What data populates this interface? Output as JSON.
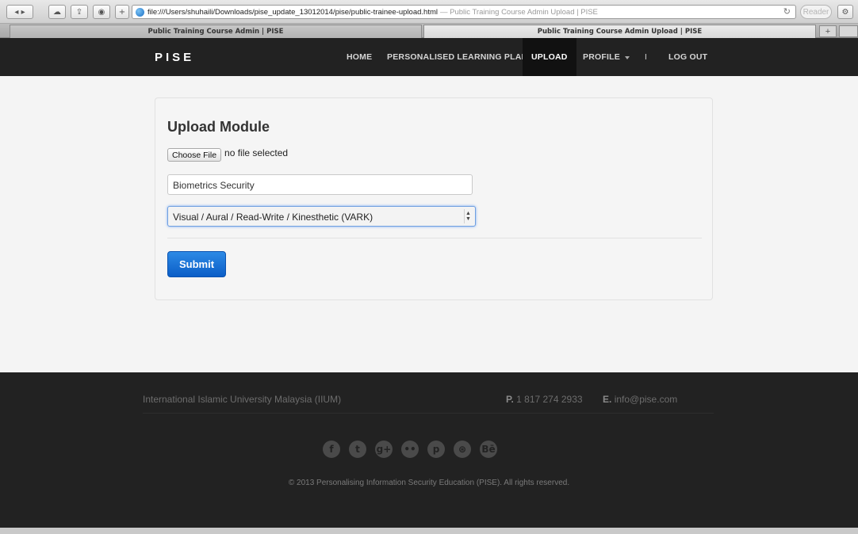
{
  "browser": {
    "url_path": "file:///Users/shuhaili/Downloads/pise_update_13012014/pise/public-trainee-upload.html",
    "url_title": "— Public Training Course Admin Upload | PISE",
    "reader_label": "Reader",
    "tabs": [
      {
        "label": "Public Training Course Admin | PISE"
      },
      {
        "label": "Public Training Course Admin Upload | PISE"
      }
    ]
  },
  "nav": {
    "brand": "PISE",
    "items": [
      {
        "label": "HOME"
      },
      {
        "label": "PERSONALISED LEARNING PLAN"
      },
      {
        "label": "UPLOAD"
      },
      {
        "label": "PROFILE"
      },
      {
        "label": "LOG OUT"
      }
    ],
    "separator": "I"
  },
  "form": {
    "title": "Upload Module",
    "choose_file_label": "Choose File",
    "file_status": "no file selected",
    "module_name_value": "Biometrics Security",
    "style_select_value": "Visual / Aural / Read-Write / Kinesthetic (VARK)",
    "submit_label": "Submit"
  },
  "footer": {
    "org": "International Islamic University Malaysia (IIUM)",
    "phone_label": "P.",
    "phone": "1 817 274 2933",
    "email_label": "E.",
    "email": "info@pise.com",
    "social": [
      {
        "icon": "facebook-icon",
        "glyph": "f"
      },
      {
        "icon": "twitter-icon",
        "glyph": "t"
      },
      {
        "icon": "google-plus-icon",
        "glyph": "g+"
      },
      {
        "icon": "flickr-icon",
        "glyph": "••"
      },
      {
        "icon": "pinterest-icon",
        "glyph": "p"
      },
      {
        "icon": "dribbble-icon",
        "glyph": "⊛"
      },
      {
        "icon": "behance-icon",
        "glyph": "Bē"
      }
    ],
    "copyright": "© 2013 Personalising Information Security Education (PISE). All rights reserved."
  }
}
